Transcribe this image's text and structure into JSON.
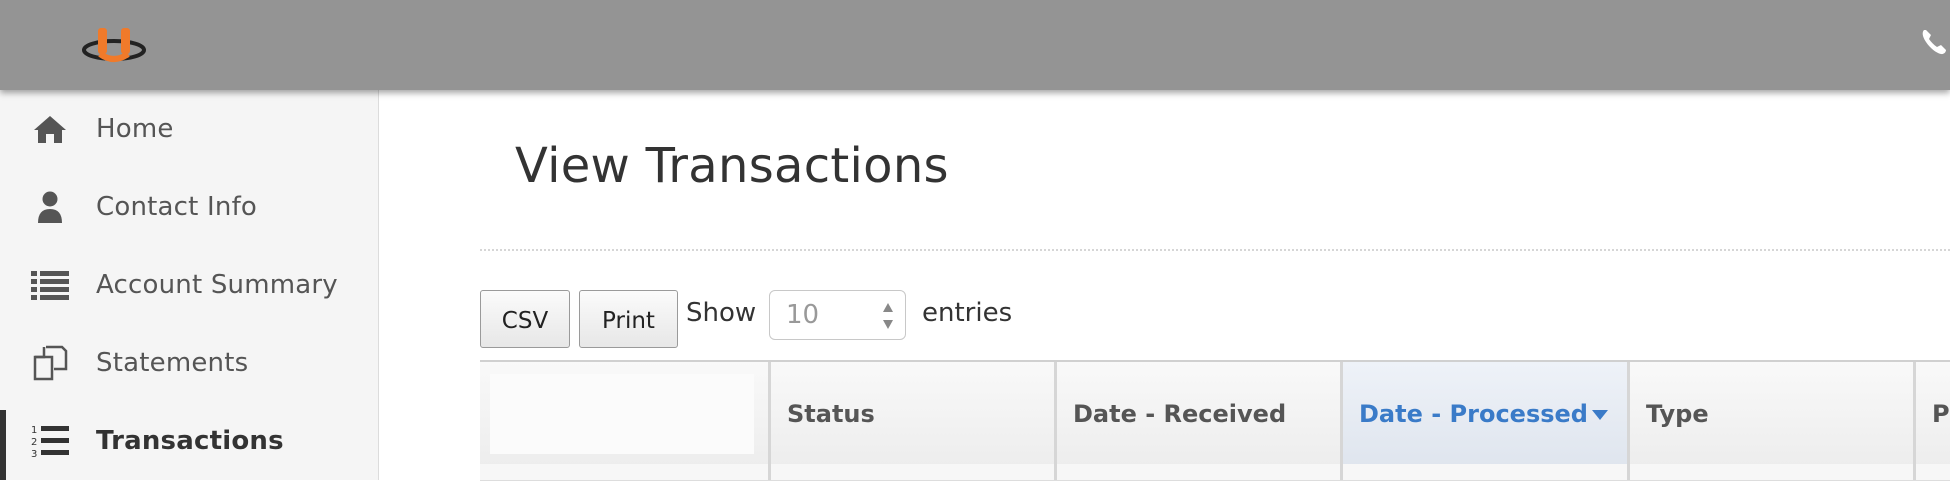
{
  "header": {
    "logo_icon": "ring-logo-icon",
    "phone_icon": "phone-icon",
    "brand_color": "#f07a2a"
  },
  "sidebar": {
    "items": [
      {
        "label": "Home",
        "icon": "home-icon",
        "active": false
      },
      {
        "label": "Contact Info",
        "icon": "user-icon",
        "active": false
      },
      {
        "label": "Account Summary",
        "icon": "list-icon",
        "active": false
      },
      {
        "label": "Statements",
        "icon": "documents-icon",
        "active": false
      },
      {
        "label": "Transactions",
        "icon": "ordered-list-icon",
        "active": true
      }
    ]
  },
  "main": {
    "title": "View Transactions",
    "toolbar": {
      "csv_label": "CSV",
      "print_label": "Print",
      "show_label": "Show",
      "entries_value": "10",
      "entries_label": "entries"
    },
    "table": {
      "columns": [
        "",
        "Status",
        "Date - Received",
        "Date - Processed",
        "Type",
        "Pa"
      ],
      "sorted_column": "Date - Processed",
      "sort_direction": "descending",
      "accent_color": "#3a7bc8"
    }
  }
}
